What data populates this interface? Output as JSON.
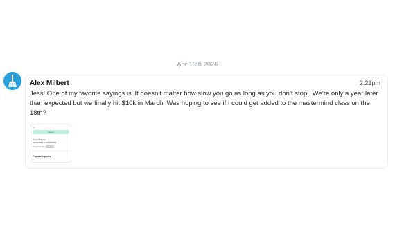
{
  "date_separator": "Apr 13th 2026",
  "message": {
    "author": "Alex Milbert",
    "time": "2:21pm",
    "text": "Jess! One of my favorite sayings is ‘It doesn’t matter how slow you go as long as you don’t stop’. We’re only a year later than expected but we finally hit $10k in March! Was hoping to see if I could get added to the mastermind class on the 18th?",
    "avatar_icon": "broom-icon",
    "avatar_color": "#2aa1dc"
  },
  "attachment": {
    "top_text": "All",
    "bar_label": "Search",
    "line1": "Report Section",
    "line2": "03/09/2026 to 03/15/2026",
    "line3": "Report status",
    "chip": "Pending",
    "popular": "Popular reports",
    "bar_color": "#bfeedd"
  }
}
